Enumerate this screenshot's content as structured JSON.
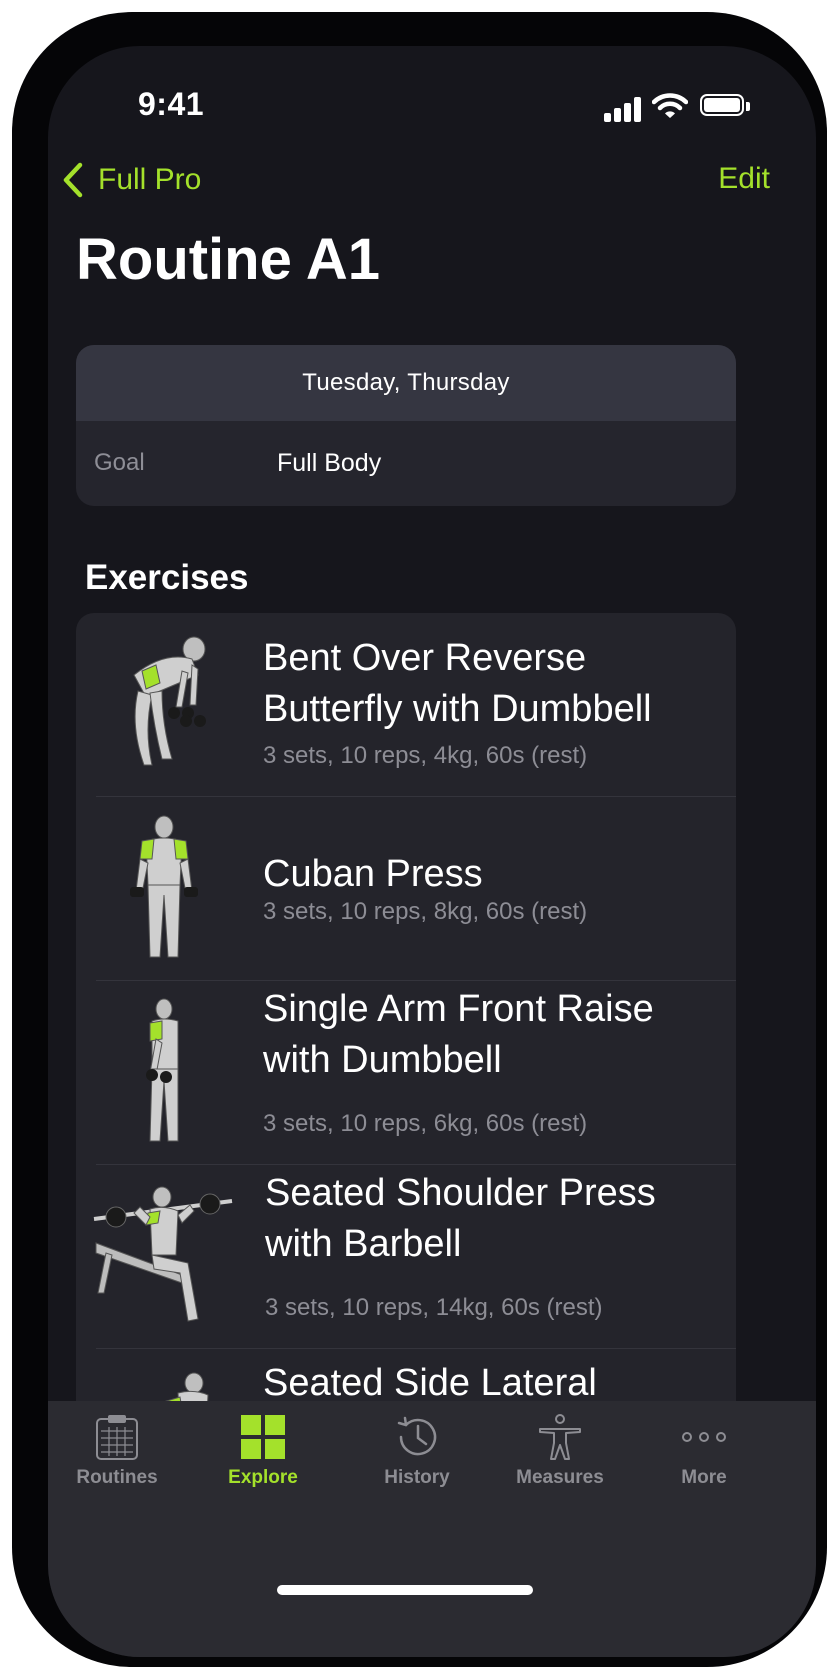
{
  "status_bar": {
    "time": "9:41"
  },
  "nav": {
    "back_label": "Full Pro",
    "edit_label": "Edit"
  },
  "title": "Routine A1",
  "info": {
    "days": "Tuesday, Thursday",
    "goal_label": "Goal",
    "goal_value": "Full Body"
  },
  "section_title": "Exercises",
  "exercises": [
    {
      "name": "Bent Over Reverse Butterfly with Dumbbell",
      "meta": "3 sets, 10 reps, 4kg, 60s (rest)"
    },
    {
      "name": "Cuban Press",
      "meta": "3 sets, 10 reps, 8kg, 60s (rest)"
    },
    {
      "name": "Single Arm Front Raise with Dumbbell",
      "meta": "3 sets, 10 reps, 6kg, 60s (rest)"
    },
    {
      "name": "Seated Shoulder Press with Barbell",
      "meta": "3 sets, 10 reps, 14kg, 60s (rest)"
    },
    {
      "name": "Seated Side Lateral"
    }
  ],
  "tabs": [
    {
      "label": "Routines",
      "icon": "clipboard-icon"
    },
    {
      "label": "Explore",
      "icon": "grid-icon",
      "active": true
    },
    {
      "label": "History",
      "icon": "history-clock-icon"
    },
    {
      "label": "Measures",
      "icon": "body-figure-icon"
    },
    {
      "label": "More",
      "icon": "ellipsis-icon"
    }
  ],
  "colors": {
    "accent": "#a4e12b",
    "background": "#16161c",
    "card": "#25252d",
    "tab_bar": "#2b2b31"
  }
}
